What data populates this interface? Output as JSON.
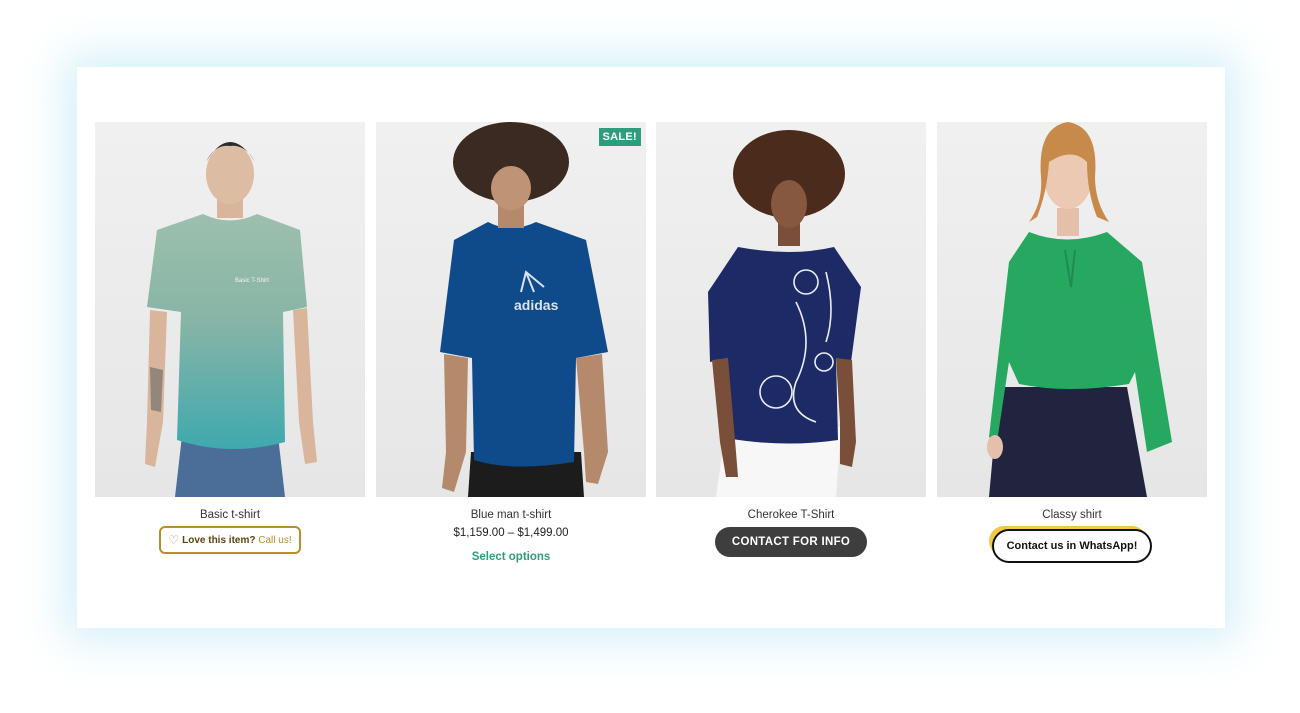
{
  "products": [
    {
      "title": "Basic t-shirt",
      "image_alt": "Man in green gradient t-shirt",
      "love_button": {
        "heart_icon": "heart-outline-icon",
        "text_strong": "Love this item?",
        "text_call": "Call us!"
      }
    },
    {
      "title": "Blue man t-shirt",
      "badge": "SALE!",
      "price": "$1,159.00 – $1,499.00",
      "action": "Select options"
    },
    {
      "title": "Cherokee T-Shirt",
      "action": "CONTACT FOR INFO"
    },
    {
      "title": "Classy shirt",
      "action": "Contact us in WhatsApp!"
    }
  ],
  "colors": {
    "accent_green": "#2e9d7e",
    "gold": "#b8902a",
    "dark_button": "#3e3e3e",
    "whatsapp_shadow": "#f0c94a"
  }
}
